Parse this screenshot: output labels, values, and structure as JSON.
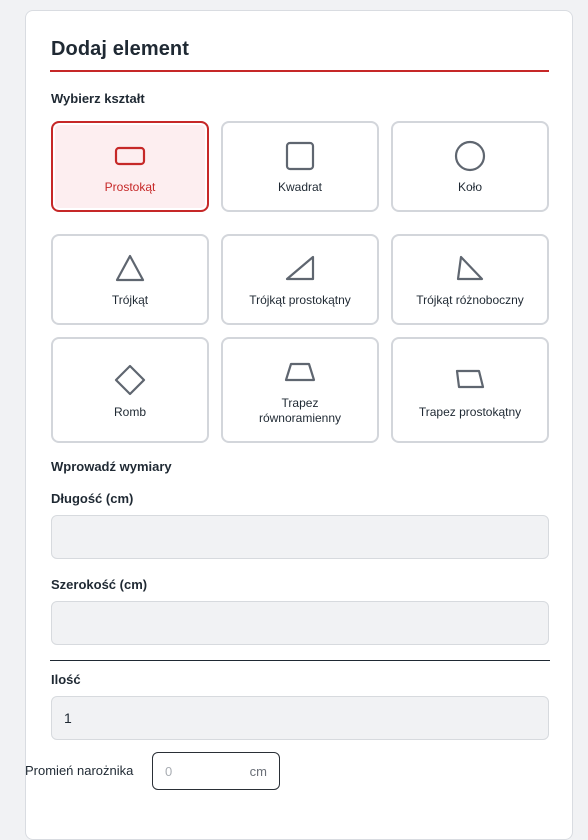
{
  "panel": {
    "title": "Dodaj element",
    "accent_color": "#c62828"
  },
  "shape_section": {
    "label": "Wybierz kształt",
    "selected": "Prostokąt",
    "shapes": [
      {
        "label": "Prostokąt",
        "icon": "rectangle-icon"
      },
      {
        "label": "Kwadrat",
        "icon": "square-icon"
      },
      {
        "label": "Koło",
        "icon": "circle-icon"
      },
      {
        "label": "Trójkąt",
        "icon": "triangle-icon"
      },
      {
        "label": "Trójkąt prostokątny",
        "icon": "right-triangle-icon"
      },
      {
        "label": "Trójkąt różnoboczny",
        "icon": "scalene-triangle-icon"
      },
      {
        "label": "Romb",
        "icon": "rhombus-icon"
      },
      {
        "label_line1": "Trapez",
        "label_line2": "równoramienny",
        "icon": "isosceles-trapezoid-icon"
      },
      {
        "label": "Trapez prostokątny",
        "icon": "right-trapezoid-icon"
      }
    ]
  },
  "dimensions": {
    "label": "Wprowadź wymiary",
    "length_label": "Długość (cm)",
    "length_value": "",
    "width_label": "Szerokość (cm)",
    "width_value": ""
  },
  "quantity": {
    "label": "Ilość",
    "value": "1"
  },
  "corner_radius": {
    "label": "Promień narożnika",
    "placeholder": "0",
    "unit": "cm"
  }
}
